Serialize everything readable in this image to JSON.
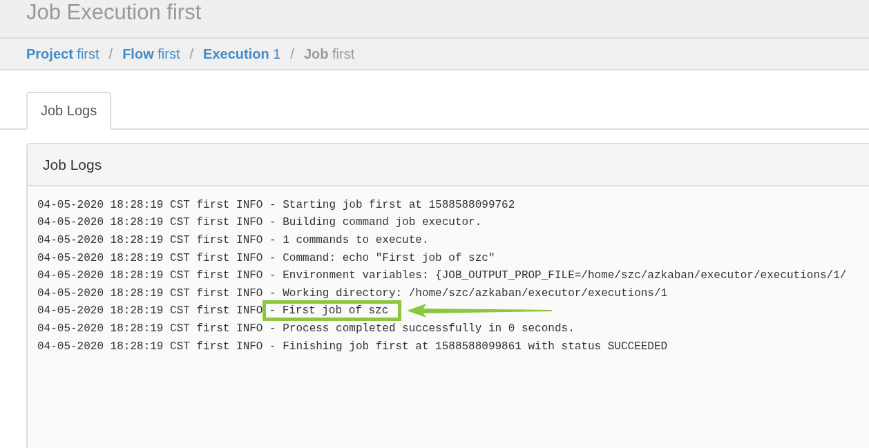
{
  "header": {
    "title": "Job Execution first"
  },
  "breadcrumb_separator": "/",
  "breadcrumb": [
    {
      "label": "Project",
      "value": "first",
      "active": false
    },
    {
      "label": "Flow",
      "value": "first",
      "active": false
    },
    {
      "label": "Execution",
      "value": "1",
      "active": false
    },
    {
      "label": "Job",
      "value": "first",
      "active": true
    }
  ],
  "tabs": [
    {
      "label": "Job Logs",
      "selected": true
    }
  ],
  "panel": {
    "title": "Job Logs",
    "lines": [
      {
        "text": "04-05-2020 18:28:19 CST first INFO - Starting job first at 1588588099762"
      },
      {
        "text": "04-05-2020 18:28:19 CST first INFO - Building command job executor."
      },
      {
        "text": "04-05-2020 18:28:19 CST first INFO - 1 commands to execute."
      },
      {
        "text": "04-05-2020 18:28:19 CST first INFO - Command: echo \"First job of szc\""
      },
      {
        "text": "04-05-2020 18:28:19 CST first INFO - Environment variables: {JOB_OUTPUT_PROP_FILE=/home/szc/azkaban/executor/executions/1/"
      },
      {
        "text": "04-05-2020 18:28:19 CST first INFO - Working directory: /home/szc/azkaban/executor/executions/1"
      },
      {
        "text": "04-05-2020 18:28:19 CST first INFO",
        "highlight": "- First job of szc"
      },
      {
        "text": "04-05-2020 18:28:19 CST first INFO - Process completed successfully in 0 seconds."
      },
      {
        "text": "04-05-2020 18:28:19 CST first INFO - Finishing job first at 1588588099861 with status SUCCEEDED"
      }
    ]
  }
}
